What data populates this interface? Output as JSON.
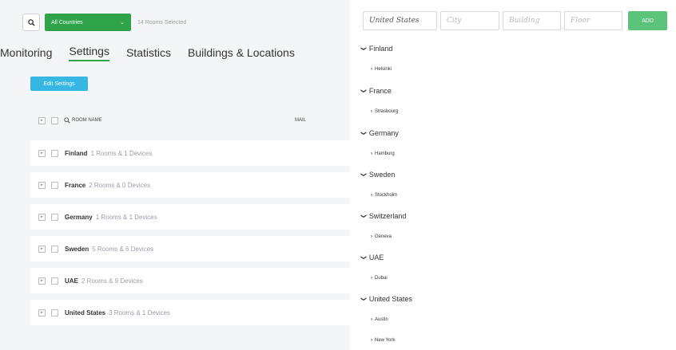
{
  "toolbar": {
    "country_select": "All Countries",
    "rooms_selected": "14 Rooms Selected"
  },
  "tabs": [
    {
      "label": "Monitoring"
    },
    {
      "label": "Settings"
    },
    {
      "label": "Statistics"
    },
    {
      "label": "Buildings & Locations"
    }
  ],
  "edit_settings_label": "Edit Settings",
  "table": {
    "col_room_name": "ROOM NAME",
    "col_mail": "MAIL",
    "rows": [
      {
        "name": "Finland",
        "meta": "1 Rooms & 1 Devices"
      },
      {
        "name": "France",
        "meta": "2 Rooms & 0 Devices"
      },
      {
        "name": "Germany",
        "meta": "1 Rooms & 1 Devices"
      },
      {
        "name": "Sweden",
        "meta": "5 Rooms & 6 Devices"
      },
      {
        "name": "UAE",
        "meta": "2 Rooms & 9 Devices"
      },
      {
        "name": "United States",
        "meta": "3 Rooms & 1 Devices"
      }
    ]
  },
  "form": {
    "country_value": "United States",
    "city_placeholder": "City",
    "building_placeholder": "Building",
    "floor_placeholder": "Floor",
    "add_label": "ADD"
  },
  "tree": [
    {
      "country": "Finland",
      "cities": [
        "Helsinki"
      ]
    },
    {
      "country": "France",
      "cities": [
        "Strasbourg"
      ]
    },
    {
      "country": "Germany",
      "cities": [
        "Hamburg"
      ]
    },
    {
      "country": "Sweden",
      "cities": [
        "Stockholm"
      ]
    },
    {
      "country": "Switzerland",
      "cities": [
        "Geneva"
      ]
    },
    {
      "country": "UAE",
      "cities": [
        "Dubai"
      ]
    },
    {
      "country": "United States",
      "cities": [
        "Austin",
        "New York"
      ]
    }
  ],
  "colors": {
    "accent_green": "#2fa34a",
    "edit_blue": "#35b6e3",
    "add_green": "#5bc47a"
  }
}
